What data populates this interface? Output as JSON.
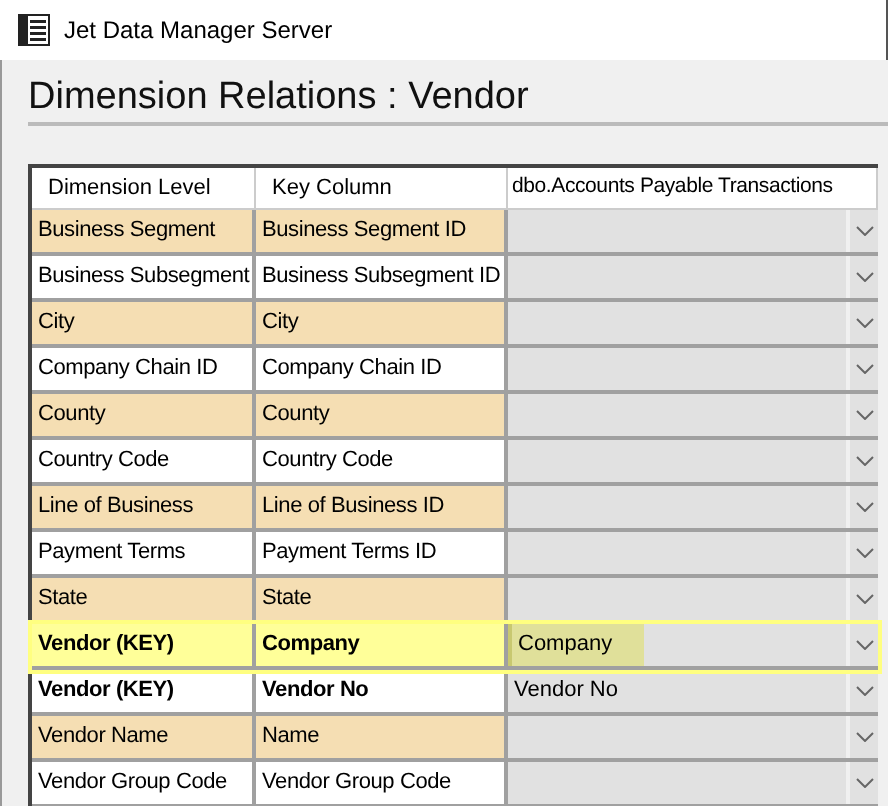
{
  "window": {
    "title": "Jet Data Manager Server"
  },
  "heading": "Dimension Relations : Vendor",
  "table": {
    "columns": [
      "Dimension Level",
      "Key Column",
      "dbo.Accounts Payable Transactions"
    ],
    "rows": [
      {
        "dimension_level": "Business Segment",
        "key_column": "Business Segment ID",
        "shaded": true,
        "key": false,
        "selected": false
      },
      {
        "dimension_level": "Business Subsegment",
        "key_column": "Business Subsegment ID",
        "shaded": false,
        "key": false,
        "selected": false
      },
      {
        "dimension_level": "City",
        "key_column": "City",
        "shaded": true,
        "key": false,
        "selected": false
      },
      {
        "dimension_level": "Company Chain ID",
        "key_column": "Company Chain ID",
        "shaded": false,
        "key": false,
        "selected": false
      },
      {
        "dimension_level": "County",
        "key_column": "County",
        "shaded": true,
        "key": false,
        "selected": false
      },
      {
        "dimension_level": "Country Code",
        "key_column": "Country Code",
        "shaded": false,
        "key": false,
        "selected": false
      },
      {
        "dimension_level": "Line of Business",
        "key_column": "Line of Business ID",
        "shaded": true,
        "key": false,
        "selected": false
      },
      {
        "dimension_level": "Payment Terms",
        "key_column": "Payment Terms ID",
        "shaded": false,
        "key": false,
        "selected": false
      },
      {
        "dimension_level": "State",
        "key_column": "State",
        "shaded": true,
        "key": false,
        "selected": false
      },
      {
        "dimension_level": "Vendor (KEY)",
        "key_column": "Company",
        "value": "Company",
        "key": true,
        "selected": true
      },
      {
        "dimension_level": "Vendor (KEY)",
        "key_column": "Vendor No",
        "value": "Vendor No",
        "shaded": false,
        "key": true,
        "selected": false
      },
      {
        "dimension_level": "Vendor Name",
        "key_column": "Name",
        "shaded": true,
        "key": false,
        "selected": false
      },
      {
        "dimension_level": "Vendor Group Code",
        "key_column": "Vendor Group Code",
        "shaded": false,
        "key": false,
        "selected": false
      }
    ]
  }
}
